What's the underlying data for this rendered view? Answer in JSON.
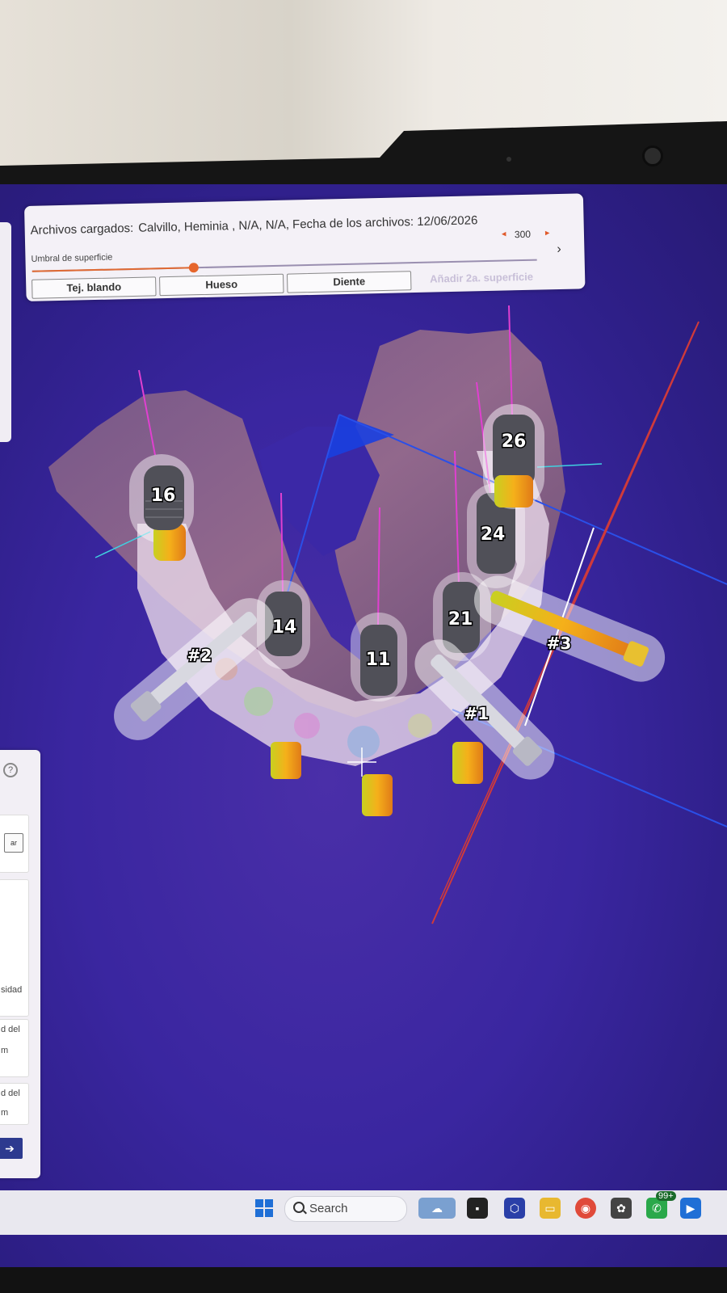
{
  "topbar": {
    "files_label": "Archivos cargados:",
    "files_value": "Calvillo, Heminia , N/A, N/A, Fecha de los archivos: 12/06/2026",
    "threshold_label": "Umbral de superficie",
    "threshold_value": "300",
    "threshold_fraction": 0.32,
    "buttons": [
      "Tej. blando",
      "Hueso",
      "Diente"
    ],
    "add_surface": "Añadir 2a. superficie"
  },
  "implants": [
    "16",
    "14",
    "11",
    "21",
    "24",
    "26"
  ],
  "screws": [
    "#1",
    "#2",
    "#3"
  ],
  "left_panel": {
    "button_fragment": "ar",
    "fragments": [
      "sidad",
      "d del",
      "m",
      "d del",
      "m"
    ]
  },
  "taskbar": {
    "search_placeholder": "Search",
    "notification_badge": "99+"
  },
  "colors": {
    "viewport_bg": "#3a26a0",
    "slider_accent": "#e6662c",
    "implant_gold": "#f0b020"
  }
}
